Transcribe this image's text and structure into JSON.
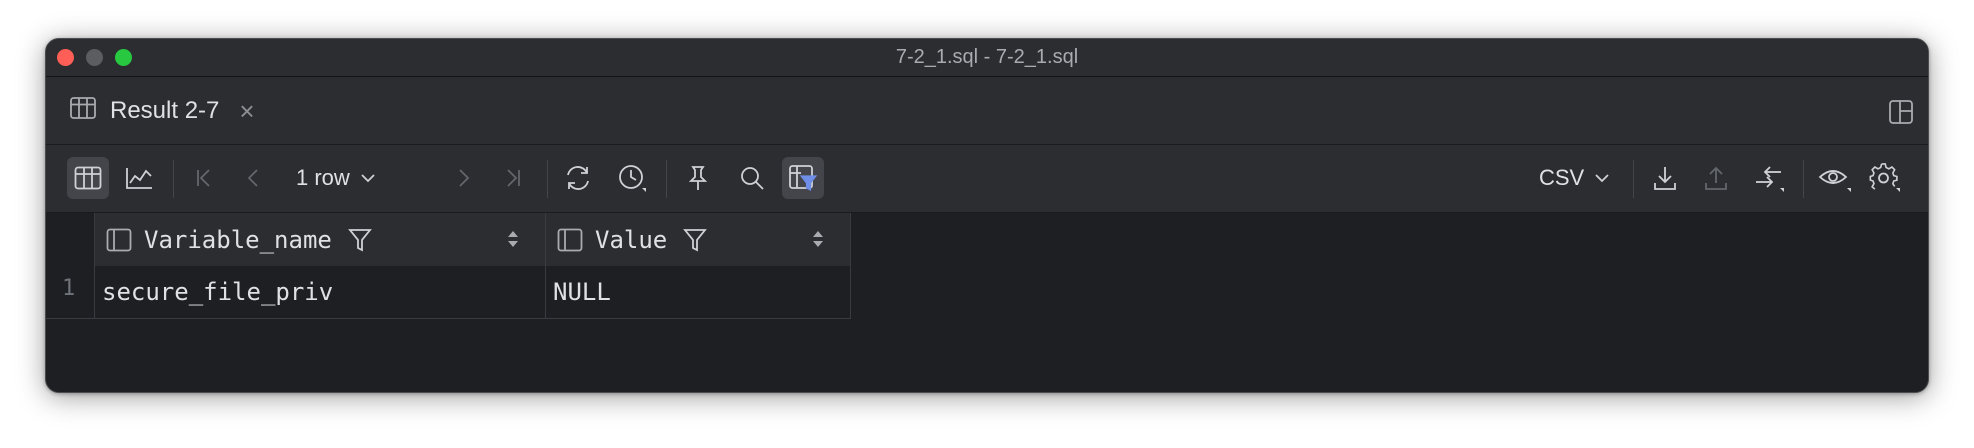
{
  "window": {
    "title": "7-2_1.sql - 7-2_1.sql"
  },
  "tabs": [
    {
      "label": "Result 2-7",
      "icon": "table-icon",
      "closable": true
    }
  ],
  "toolbar": {
    "rows_label": "1 row",
    "export_format": "CSV",
    "active_tools": [
      "table-view",
      "filter-toggle"
    ],
    "accent_color": "#6f8ee8"
  },
  "table": {
    "columns": [
      {
        "name": "Variable_name"
      },
      {
        "name": "Value"
      }
    ],
    "rows": [
      {
        "number": "1",
        "cells": [
          "secure_file_priv",
          "NULL"
        ]
      }
    ]
  },
  "colors": {
    "window_bg": "#1e1f22",
    "panel_bg": "#2b2d30",
    "text": "#dfe1e5",
    "traffic_close": "#ff5f57",
    "traffic_max": "#28c840"
  }
}
